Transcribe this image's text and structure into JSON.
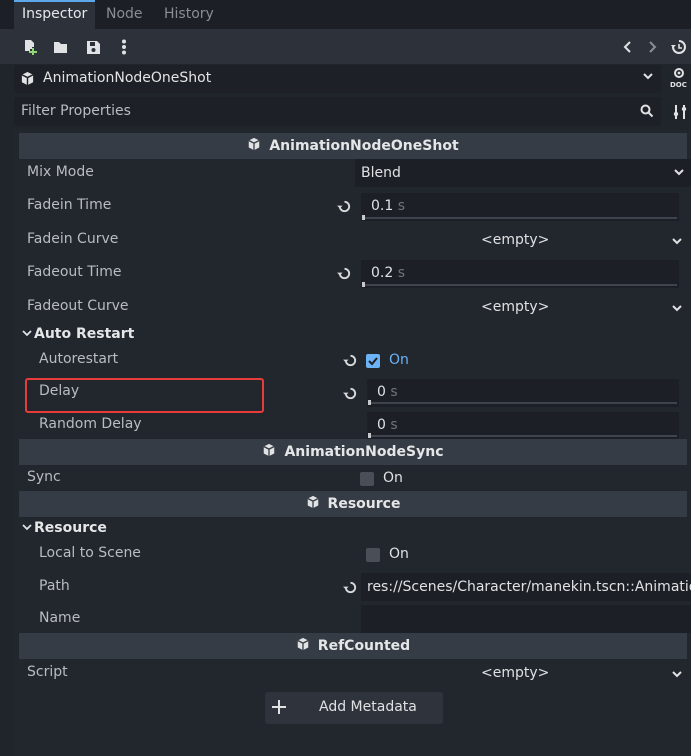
{
  "tabs": [
    {
      "label": "Inspector",
      "active": true
    },
    {
      "label": "Node",
      "active": false
    },
    {
      "label": "History",
      "active": false
    }
  ],
  "toolbar": {
    "icons": [
      "new-resource-icon",
      "open-folder-icon",
      "save-icon",
      "more-vertical-icon",
      "history-back-icon",
      "history-forward-icon",
      "object-history-icon"
    ]
  },
  "object_selector": {
    "value": "AnimationNodeOneShot",
    "doc_label": "DOC"
  },
  "filter": {
    "placeholder": "Filter Properties"
  },
  "sections": {
    "oneshot_header": "AnimationNodeOneShot",
    "mix_mode": {
      "label": "Mix Mode",
      "value": "Blend"
    },
    "fadein_time": {
      "label": "Fadein Time",
      "value": "0.1",
      "unit": "s"
    },
    "fadein_curve": {
      "label": "Fadein Curve",
      "value": "<empty>"
    },
    "fadeout_time": {
      "label": "Fadeout Time",
      "value": "0.2",
      "unit": "s"
    },
    "fadeout_curve": {
      "label": "Fadeout Curve",
      "value": "<empty>"
    },
    "auto_restart_group": "Auto Restart",
    "autorestart": {
      "label": "Autorestart",
      "value": "On",
      "checked": true
    },
    "delay": {
      "label": "Delay",
      "value": "0",
      "unit": "s"
    },
    "random_delay": {
      "label": "Random Delay",
      "value": "0",
      "unit": "s"
    },
    "sync_header": "AnimationNodeSync",
    "sync": {
      "label": "Sync",
      "value": "On",
      "checked": false
    },
    "resource_header": "Resource",
    "resource_group": "Resource",
    "local_to_scene": {
      "label": "Local to Scene",
      "value": "On",
      "checked": false
    },
    "path": {
      "label": "Path",
      "value": "res://Scenes/Character/manekin.tscn::Animatio"
    },
    "name": {
      "label": "Name",
      "value": ""
    },
    "refcounted_header": "RefCounted",
    "script": {
      "label": "Script",
      "value": "<empty>"
    }
  },
  "add_metadata": {
    "label": "Add Metadata"
  },
  "colors": {
    "accent": "#5ca8ea",
    "checkbox_on": "#6bb3f5",
    "highlight": "#e83c3c"
  }
}
